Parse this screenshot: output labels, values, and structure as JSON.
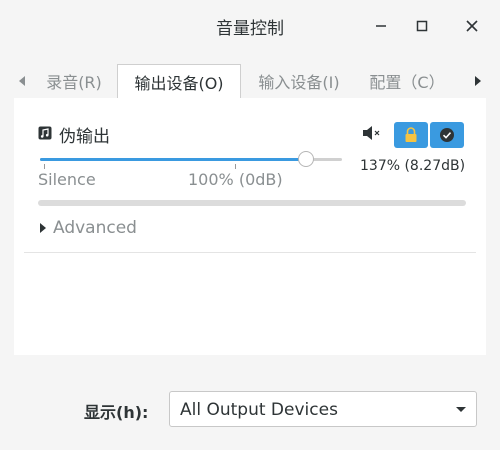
{
  "window": {
    "title": "音量控制",
    "controls": [
      "minimize-icon",
      "maximize-icon",
      "close-icon"
    ]
  },
  "tabs": [
    {
      "label": "录音(R)",
      "active": false
    },
    {
      "label": "输出设备(O)",
      "active": true
    },
    {
      "label": "输入设备(I)",
      "active": false
    },
    {
      "label": "配置（C）",
      "active": false
    }
  ],
  "device": {
    "name": "伪输出",
    "icon": "audio-card-icon",
    "volume_percent": 137,
    "volume_text": "137% (8.27dB)",
    "marks": {
      "silence": "Silence",
      "normal": "100% (0dB)"
    },
    "level_percent": 0
  },
  "advanced_label": "Advanced",
  "footer": {
    "show_label": "显示(h):",
    "selected_option": "All Output Devices"
  },
  "colors": {
    "accent": "#3a9ae0",
    "background": "#f5f5f5",
    "panel": "#ffffff"
  }
}
